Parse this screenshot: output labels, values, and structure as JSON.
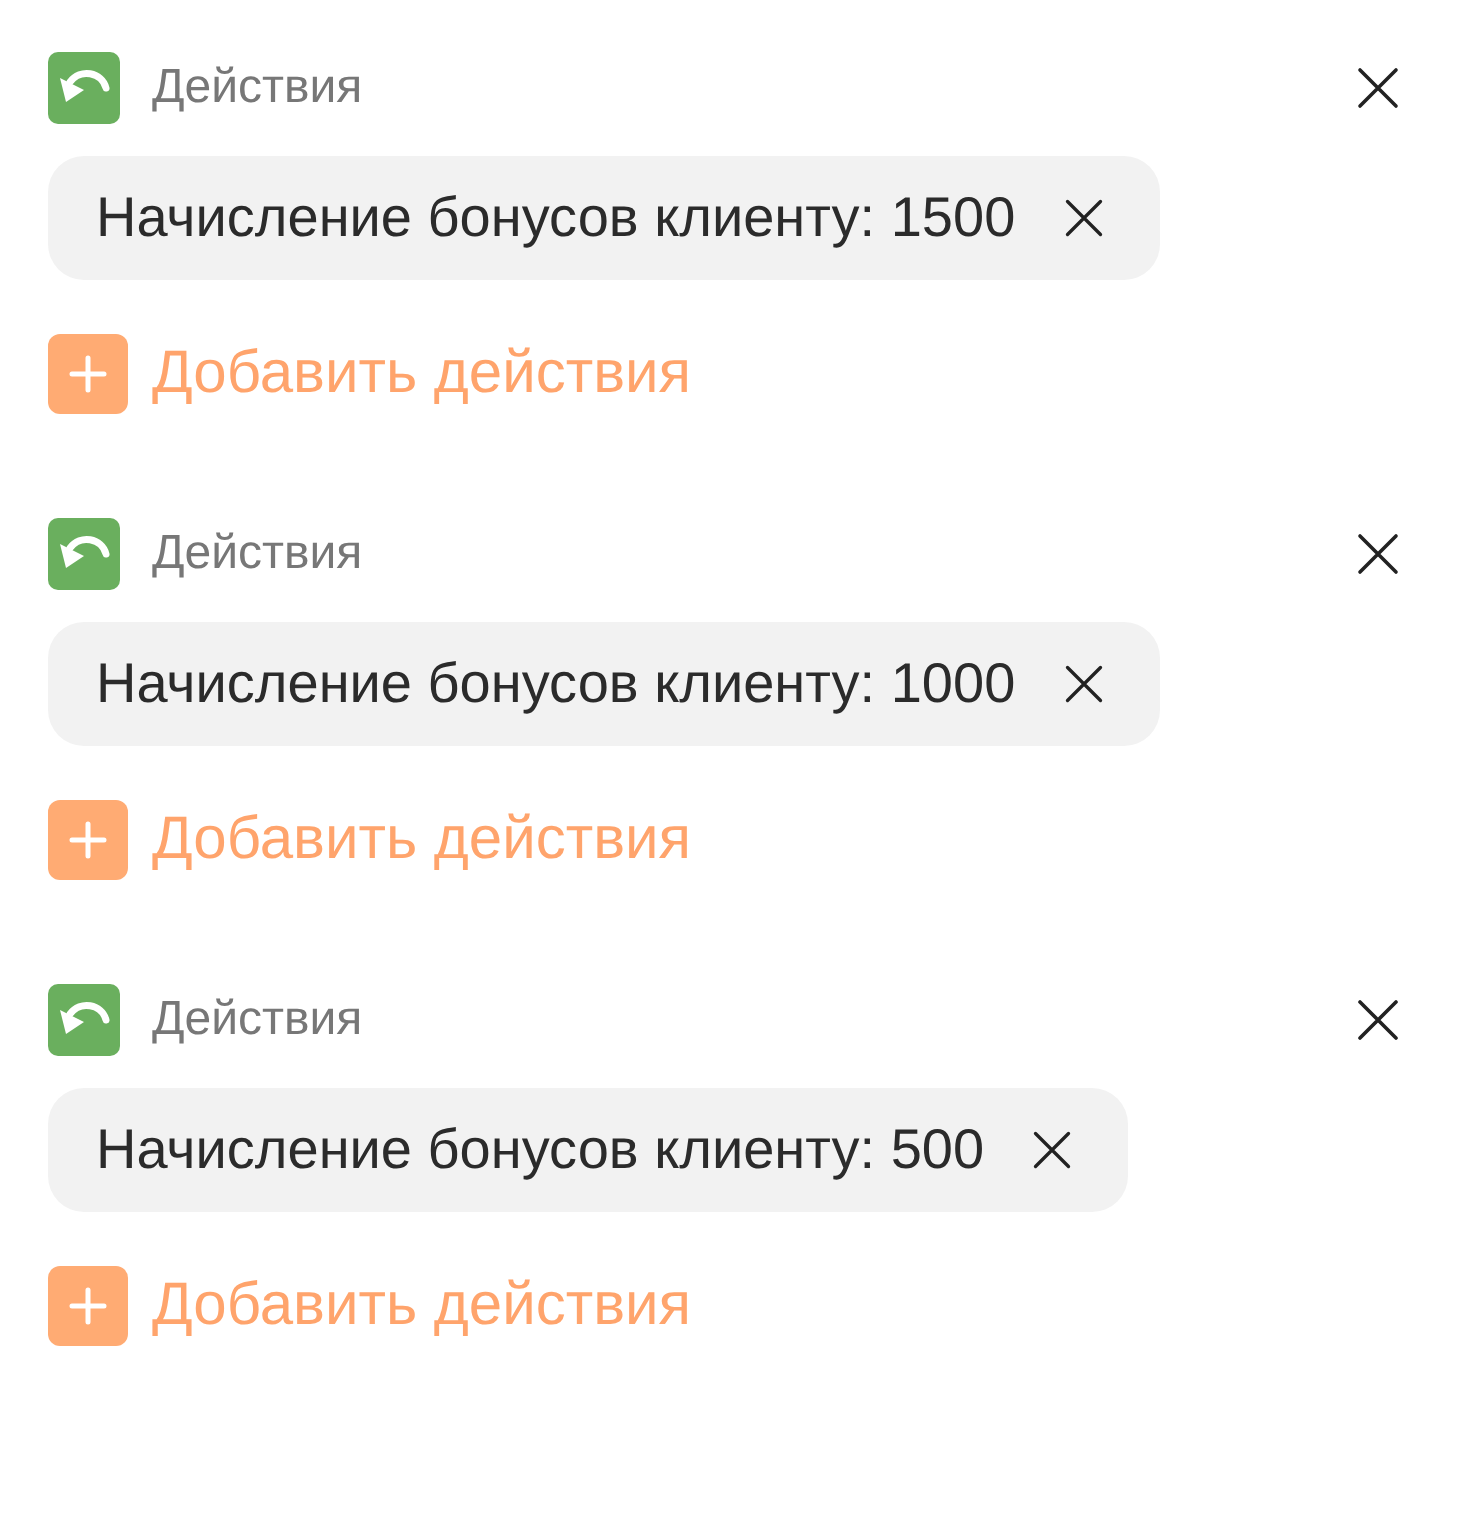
{
  "action_blocks": [
    {
      "title": "Действия",
      "actions": [
        {
          "label": "Начисление бонусов клиенту: 1500"
        }
      ],
      "add_label": "Добавить действия"
    },
    {
      "title": "Действия",
      "actions": [
        {
          "label": "Начисление бонусов клиенту: 1000"
        }
      ],
      "add_label": "Добавить действия"
    },
    {
      "title": "Действия",
      "actions": [
        {
          "label": "Начисление бонусов клиенту: 500"
        }
      ],
      "add_label": "Добавить действия"
    }
  ]
}
